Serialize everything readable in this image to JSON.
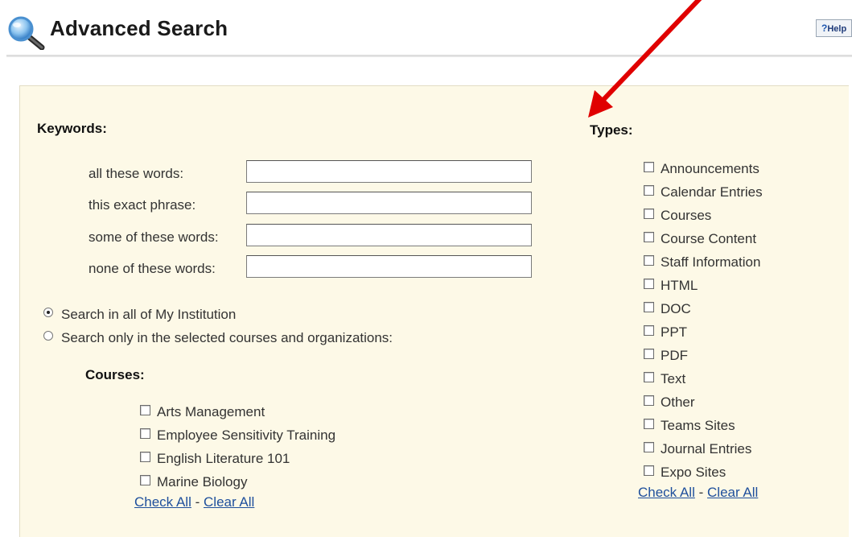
{
  "header": {
    "title": "Advanced Search",
    "help_label": "Help"
  },
  "keywords": {
    "heading": "Keywords:",
    "fields": [
      {
        "label": "all these words:",
        "value": ""
      },
      {
        "label": "this exact phrase:",
        "value": ""
      },
      {
        "label": "some of these words:",
        "value": ""
      },
      {
        "label": "none of these words:",
        "value": ""
      }
    ]
  },
  "scope": {
    "options": [
      {
        "label": "Search in all of My Institution",
        "selected": true
      },
      {
        "label": "Search only in the selected courses and organizations:",
        "selected": false
      }
    ]
  },
  "courses": {
    "heading": "Courses:",
    "items": [
      "Arts Management",
      "Employee Sensitivity Training",
      "English Literature 101",
      "Marine Biology"
    ],
    "check_all": "Check All",
    "separator": "-",
    "clear_all": "Clear All"
  },
  "types": {
    "heading": "Types:",
    "items": [
      "Announcements",
      "Calendar Entries",
      "Courses",
      "Course Content",
      "Staff Information",
      "HTML",
      "DOC",
      "PPT",
      "PDF",
      "Text",
      "Other",
      "Teams Sites",
      "Journal Entries",
      "Expo Sites"
    ],
    "check_all": "Check All",
    "separator": "-",
    "clear_all": "Clear All"
  },
  "colors": {
    "panel_bg": "#fdf9e7",
    "link": "#1e4f9c",
    "annotation_arrow": "#e00000"
  }
}
